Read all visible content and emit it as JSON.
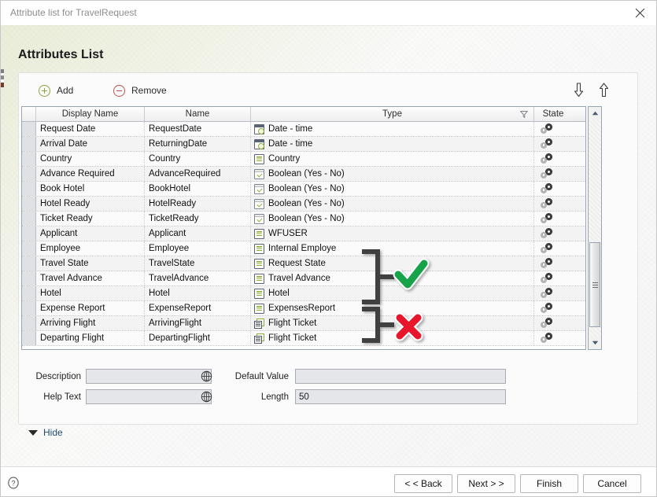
{
  "window": {
    "caption": "Attribute list for TravelRequest",
    "close_icon": "close-icon"
  },
  "page": {
    "title": "Attributes List",
    "hide_label": "Hide"
  },
  "toolbar": {
    "add_label": "Add",
    "remove_label": "Remove",
    "move_down_icon": "arrow-down-icon",
    "move_up_icon": "arrow-up-icon"
  },
  "grid": {
    "columns": [
      "",
      "Display Name",
      "Name",
      "Type",
      "State"
    ],
    "sort_indicator": "filter-funnel-icon",
    "rows": [
      {
        "display_name": "Request Date",
        "name": "RequestDate",
        "type": "Date - time",
        "type_icon": "date-time-icon",
        "state_icon": "gears-icon"
      },
      {
        "display_name": "Arrival Date",
        "name": "ReturningDate",
        "type": "Date - time",
        "type_icon": "date-time-icon",
        "state_icon": "gears-icon"
      },
      {
        "display_name": "Country",
        "name": "Country",
        "type": "Country",
        "type_icon": "entity-icon",
        "state_icon": "gears-icon"
      },
      {
        "display_name": "Advance Required",
        "name": "AdvanceRequired",
        "type": "Boolean (Yes - No)",
        "type_icon": "boolean-icon",
        "state_icon": "gears-icon"
      },
      {
        "display_name": "Book Hotel",
        "name": "BookHotel",
        "type": "Boolean (Yes - No)",
        "type_icon": "boolean-icon",
        "state_icon": "gears-icon"
      },
      {
        "display_name": "Hotel Ready",
        "name": "HotelReady",
        "type": "Boolean (Yes - No)",
        "type_icon": "boolean-icon",
        "state_icon": "gears-icon"
      },
      {
        "display_name": "Ticket Ready",
        "name": "TicketReady",
        "type": "Boolean (Yes - No)",
        "type_icon": "boolean-icon",
        "state_icon": "gears-icon"
      },
      {
        "display_name": "Applicant",
        "name": "Applicant",
        "type": "WFUSER",
        "type_icon": "entity-icon",
        "state_icon": "gears-icon"
      },
      {
        "display_name": "Employee",
        "name": "Employee",
        "type": "Internal Employe",
        "type_icon": "entity-icon",
        "state_icon": "gears-icon"
      },
      {
        "display_name": "Travel State",
        "name": "TravelState",
        "type": "Request State",
        "type_icon": "entity-icon",
        "state_icon": "gears-icon"
      },
      {
        "display_name": "Travel Advance",
        "name": "TravelAdvance",
        "type": "Travel Advance",
        "type_icon": "entity-icon",
        "state_icon": "gears-icon"
      },
      {
        "display_name": "Hotel",
        "name": "Hotel",
        "type": "Hotel",
        "type_icon": "entity-icon",
        "state_icon": "gears-icon"
      },
      {
        "display_name": "Expense Report",
        "name": "ExpenseReport",
        "type": "ExpensesReport",
        "type_icon": "entity-icon",
        "state_icon": "gears-icon"
      },
      {
        "display_name": "Arriving Flight",
        "name": "ArrivingFlight",
        "type": "Flight Ticket",
        "type_icon": "flight-ticket-icon",
        "state_icon": "gears-icon"
      },
      {
        "display_name": "Departing Flight",
        "name": "DepartingFlight",
        "type": "Flight Ticket",
        "type_icon": "flight-ticket-icon",
        "state_icon": "gears-icon"
      }
    ]
  },
  "scrollbar": {
    "up_icon": "scroll-up-icon",
    "down_icon": "scroll-down-icon"
  },
  "detail": {
    "description_label": "Description",
    "description_value": "",
    "help_text_label": "Help Text",
    "help_text_value": "",
    "default_value_label": "Default Value",
    "default_value_value": "",
    "length_label": "Length",
    "length_value": "50",
    "globe_icon": "globe-icon"
  },
  "footer": {
    "help_icon": "help-icon",
    "back_label": "< < Back",
    "next_label": "Next > >",
    "finish_label": "Finish",
    "cancel_label": "Cancel"
  },
  "annotations": {
    "check_mark": "green-check-icon",
    "cross_mark": "red-cross-icon",
    "bracket_top": "bracket-entity-rows",
    "bracket_bottom": "bracket-flight-rows"
  },
  "colors": {
    "accent_green": "#8fae35",
    "accent_red": "#c0504d",
    "check_green": "#18a348",
    "cross_red": "#e8192c",
    "link_blue": "#1f4b6e",
    "grid_border": "#9aa4b0"
  }
}
